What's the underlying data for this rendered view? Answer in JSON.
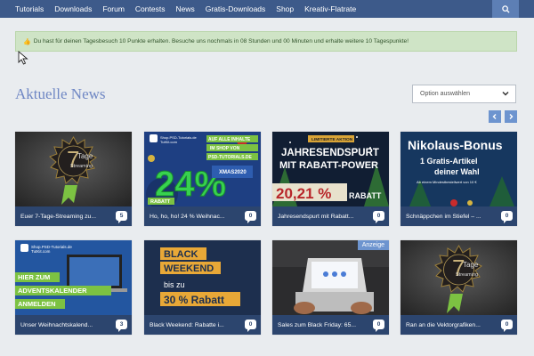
{
  "nav": {
    "items": [
      "Tutorials",
      "Downloads",
      "Forum",
      "Contests",
      "News",
      "Gratis-Downloads",
      "Shop",
      "Kreativ-Flatrate"
    ],
    "search_icon": "search-icon"
  },
  "notice": {
    "icon": "thumbs-up-icon",
    "text": "Du hast für deinen Tagesbesuch 10 Punkte erhalten. Besuche uns nochmals in 08 Stunden und 00 Minuten und erhalte weitere 10 Tagespunkte!"
  },
  "main": {
    "title": "Aktuelle News",
    "select_value": "Option auswählen"
  },
  "cards": [
    {
      "caption": "Euer 7-Tage-Streaming zu...",
      "comments": "5",
      "img": {
        "line1": "7",
        "line2": "Tage",
        "line3": "Streaming"
      }
    },
    {
      "caption": "Ho, ho, ho! 24 % Weihnac...",
      "comments": "0",
      "img": {
        "tag1": "AUF ALLE INHALTE",
        "tag2": "IM SHOP VON",
        "tag3": "PSD-TUTORIALS.DE",
        "big": "24%",
        "rabatt": "RABATT",
        "code": "XMAS2020",
        "shop": "Shop.PSD-Tutorials.de",
        "shop2": "TutKit.com"
      }
    },
    {
      "caption": "Jahresendspurt mit Rabatt...",
      "comments": "0",
      "img": {
        "tag": "LIMITIERTE AKTION",
        "l1": "JAHRESENDSPURT",
        "l2": "MIT RABATT-POWER",
        "pct": "20,21 %",
        "rabatt": "RABATT"
      }
    },
    {
      "caption": "Schnäppchen im Stiefel – ...",
      "comments": "0",
      "img": {
        "t1": "Nikolaus-Bonus",
        "t2": "1 Gratis-Artikel",
        "t3": "deiner Wahl",
        "t4": "Ab einem Mindestbestellwert von 10 €"
      }
    },
    {
      "caption": "Unser Weihnachtskalend...",
      "comments": "3",
      "img": {
        "shop": "Shop.PSD-Tutorials.de",
        "shop2": "TutKit.com",
        "b1": "HIER ZUM",
        "b2": "ADVENTSKALENDER",
        "b3": "ANMELDEN"
      }
    },
    {
      "caption": "Black Weekend: Rabatte i...",
      "comments": "0",
      "img": {
        "b1": "BLACK",
        "b2": "WEEKEND",
        "b3": "bis zu",
        "b4": "30 % Rabatt"
      }
    },
    {
      "caption": "Sales zum Black Friday: 65...",
      "comments": "0",
      "img": {
        "badge": "Anzeige"
      }
    },
    {
      "caption": "Ran an die Vektorgrafiken...",
      "comments": "0",
      "img": {
        "line1": "7",
        "line2": "Tage",
        "line3": "Streaming"
      }
    }
  ]
}
